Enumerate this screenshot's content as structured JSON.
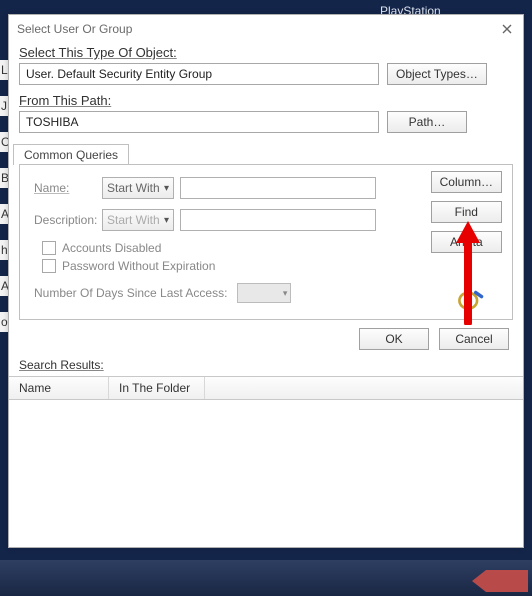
{
  "background": {
    "text_behind": "PlayStation"
  },
  "dialog": {
    "title": "Select User Or Group",
    "close_tooltip": "Close",
    "object_type_label": "Select This Type Of Object:",
    "object_type_value": "User. Default Security Entity Group",
    "object_types_btn": "Object Types…",
    "from_path_label": "From This Path:",
    "from_path_value": "TOSHIBA",
    "path_btn": "Path…",
    "queries_tab": "Common Queries",
    "queries": {
      "name_label": "Name:",
      "name_mode": "Start With",
      "desc_label": "Description:",
      "desc_mode": "Start With",
      "cb_disabled": "Accounts Disabled",
      "cb_noexpire": "Password Without Expiration",
      "days_label": "Number Of Days Since Last Access:"
    },
    "side": {
      "columns_btn": "Column…",
      "find_btn": "Find",
      "stop_btn": "Arreta"
    },
    "footer": {
      "ok": "OK",
      "cancel": "Cancel"
    },
    "results": {
      "label": "Search Results:",
      "col_name": "Name",
      "col_folder": "In The Folder"
    }
  },
  "left_fragments": [
    "Lin",
    "J",
    "Of:",
    "Be",
    "At",
    "hi",
    "AC",
    "oni"
  ]
}
